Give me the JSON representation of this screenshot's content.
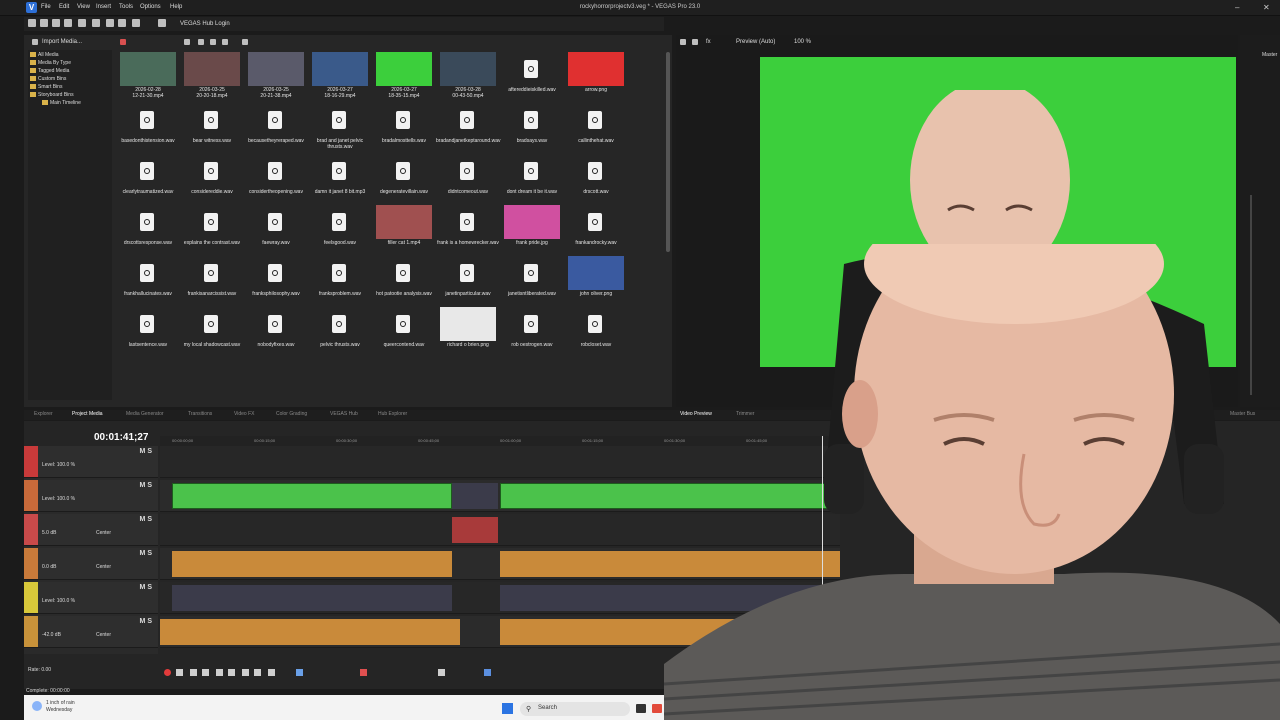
{
  "titlebar": {
    "app_logo": "V",
    "menu": [
      "File",
      "Edit",
      "View",
      "Insert",
      "Tools",
      "Options",
      "Help"
    ],
    "window_title": "rockyhorrorprojectv3.veg * - VEGAS Pro 23.0",
    "hub_login": "VEGAS Hub Login"
  },
  "explorer": {
    "import_label": "Import Media...",
    "tree": [
      "All Media",
      "Media By Type",
      "Tagged Media",
      "Custom Bins",
      "Smart Bins",
      "Storyboard Bins",
      "Main Timeline"
    ],
    "media": [
      "2026-02-28\n12-21-30.mp4",
      "2026-03-25\n20-20-18.mp4",
      "2026-03-25\n20-21-38.mp4",
      "2026-03-27\n18-16-29.mp4",
      "2026-03-27\n18-35-15.mp4",
      "2026-03-28\n00-43-50.mp4",
      "aftereddieiskilled.wav",
      "arrow.png",
      "basedonthistension.wav",
      "bear witness.wav",
      "becausetheyreraped.wav",
      "brad and janet pelvic thrusts.wav",
      "bradalmosttells.wav",
      "bradandjanetkeptaround.wav",
      "bradsays.wav",
      "callinthehat.wav",
      "clearlytraumatized.wav",
      "considereddie.wav",
      "considertheopening.wav",
      "damn it janet 8 bit.mp3",
      "degeneratevillain.wav",
      "didntcomeout.wav",
      "dont dream it be it.wav",
      "drscott.wav",
      "drscottsresponse.wav",
      "explains the contrast.wav",
      "faewray.wav",
      "feelsgood.wav",
      "filler cat 1.mp4",
      "frank is a homewrecker.wav",
      "frank pride.jpg",
      "frankandrocky.wav",
      "frankhallucinates.wav",
      "frankisanarcissist.wav",
      "franksphilosophy.wav",
      "franksproblem.wav",
      "hot patootie analysis.wav",
      "janetinparticular.wav",
      "janetisntliberated.wav",
      "john oliver.png",
      "lastsentence.wav",
      "my local shadowcast.wav",
      "nobodyfixes.wav",
      "pelvic thrusts.wav",
      "queercontend.wav",
      "richard o brien.png",
      "rob oestrogen.wav",
      "robcloset.wav"
    ]
  },
  "preview": {
    "mode_label": "Preview (Auto)",
    "zoom": "100 %",
    "master_label": "Master",
    "master_bus": "Master Bus"
  },
  "tabs": [
    "Explorer",
    "Project Media",
    "Media Generator",
    "Transitions",
    "Video FX",
    "Color Grading",
    "VEGAS Hub",
    "Hub Explorer",
    "Video Preview",
    "Trimmer"
  ],
  "timeline": {
    "time": "00:01:41;27",
    "ruler": [
      "00:00:00;00",
      "00:00:15;00",
      "00:00:30;00",
      "00:00:45;00",
      "00:01:00;00",
      "00:01:15;00",
      "00:01:30;00",
      "00:01:45;00"
    ],
    "tracks": [
      {
        "level": "Level: 100.0 %",
        "color": "#c83a3a",
        "type": "video"
      },
      {
        "level": "Level: 100.0 %",
        "color": "#c86a3a",
        "type": "video"
      },
      {
        "level": "5.0 dB",
        "center": "Center",
        "color": "#c84a4a",
        "type": "audio"
      },
      {
        "level": "0.0 dB",
        "center": "Center",
        "color": "#c87a3a",
        "type": "audio"
      },
      {
        "level": "Level: 100.0 %",
        "color": "#d8c83a",
        "type": "video"
      },
      {
        "level": "-42.0 dB",
        "center": "Center",
        "color": "#c8923a",
        "type": "audio"
      }
    ],
    "ms_label": "M  S",
    "rate": "Rate: 0.00",
    "status": "Complete: 00:00:00"
  },
  "taskbar": {
    "weather": "1 inch of rain\nWednesday",
    "search": "Search"
  },
  "colors": {
    "green_screen": "#3ccf3c",
    "audio_clip": "#c98a3a",
    "video_clip": "#4bc24b"
  }
}
